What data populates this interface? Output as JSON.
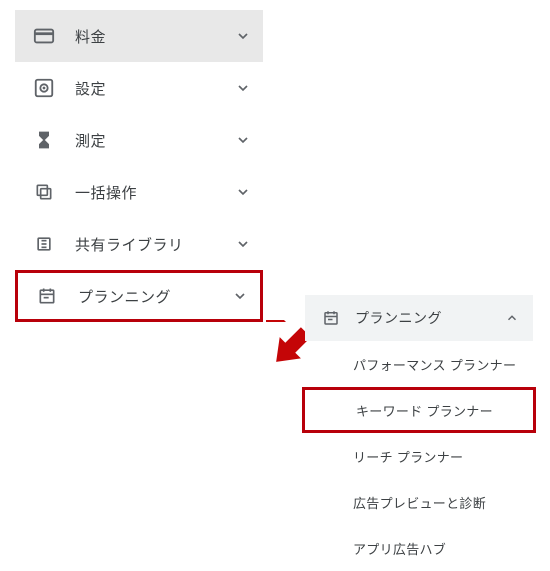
{
  "left_nav": {
    "items": [
      {
        "id": "billing",
        "label": "料金",
        "icon": "credit-card-icon",
        "active": true
      },
      {
        "id": "settings",
        "label": "設定",
        "icon": "gear-icon"
      },
      {
        "id": "measure",
        "label": "測定",
        "icon": "hourglass-icon"
      },
      {
        "id": "bulk",
        "label": "一括操作",
        "icon": "copy-icon"
      },
      {
        "id": "shared",
        "label": "共有ライブラリ",
        "icon": "library-icon"
      },
      {
        "id": "planning",
        "label": "プランニング",
        "icon": "calendar-icon",
        "highlight": true
      }
    ]
  },
  "right_panel": {
    "header": {
      "label": "プランニング",
      "icon": "calendar-icon"
    },
    "items": [
      {
        "id": "perf",
        "label": "パフォーマンス プランナー"
      },
      {
        "id": "keyword",
        "label": "キーワード プランナー",
        "highlight": true
      },
      {
        "id": "reach",
        "label": "リーチ プランナー"
      },
      {
        "id": "preview",
        "label": "広告プレビューと診断"
      },
      {
        "id": "apphub",
        "label": "アプリ広告ハブ"
      }
    ]
  }
}
